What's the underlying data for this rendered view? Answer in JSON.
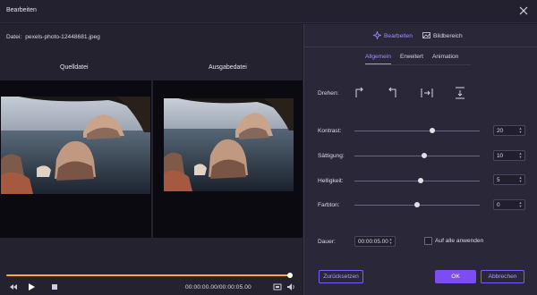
{
  "window": {
    "title": "Bearbeiten"
  },
  "file": {
    "label": "Datei:",
    "name": "pexels-photo-12448681.jpeg"
  },
  "preview": {
    "source_label": "Quelldatei",
    "output_label": "Ausgabedatei"
  },
  "player": {
    "time": "00:00:00.00/00:00:05.00",
    "progress": 0.99
  },
  "top_tabs": {
    "edit": "Bearbeiten",
    "crop": "Bildbereich"
  },
  "sub_tabs": [
    "Allgemein",
    "Erweitert",
    "Animation"
  ],
  "rotate": {
    "label": "Drehen:"
  },
  "adjustments": [
    {
      "label": "Kontrast:",
      "value": "20",
      "fraction": 0.62
    },
    {
      "label": "Sättigung:",
      "value": "10",
      "fraction": 0.56
    },
    {
      "label": "Helligkeit:",
      "value": "5",
      "fraction": 0.53
    },
    {
      "label": "Farbton:",
      "value": "0",
      "fraction": 0.5
    }
  ],
  "duration": {
    "label": "Dauer:",
    "value": "00:00:05.00"
  },
  "apply_all": {
    "label": "Auf alle anwenden",
    "checked": false
  },
  "buttons": {
    "reset": "Zurücksetzen",
    "ok": "OK",
    "cancel": "Abbrechen"
  },
  "colors": {
    "accent": "#7b4df2",
    "timeline": "#ffa63a"
  }
}
